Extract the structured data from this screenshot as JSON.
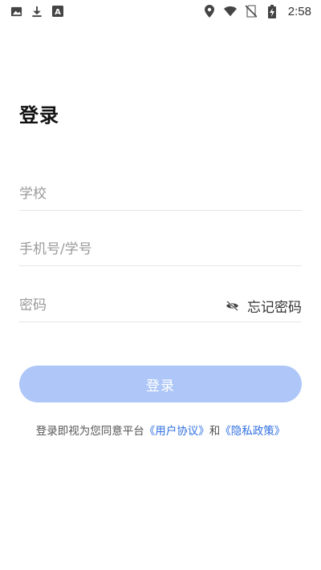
{
  "status_bar": {
    "time": "2:58",
    "icons_left": [
      "image-icon",
      "download-icon",
      "text-a-icon"
    ],
    "icons_right": [
      "location-icon",
      "wifi-icon",
      "no-sim-icon",
      "battery-charging-icon"
    ]
  },
  "page": {
    "title": "登录"
  },
  "form": {
    "school_placeholder": "学校",
    "account_placeholder": "手机号/学号",
    "password_placeholder": "密码",
    "forgot_password": "忘记密码",
    "login_button": "登录"
  },
  "agreement": {
    "prefix": "登录即视为您同意平台",
    "user_agreement": "《用户协议》",
    "conjunction": "和",
    "privacy_policy": "《隐私政策》"
  },
  "colors": {
    "accent": "#2f6fe0",
    "button_disabled": "#aec7f8",
    "divider": "#e6e6e6"
  }
}
